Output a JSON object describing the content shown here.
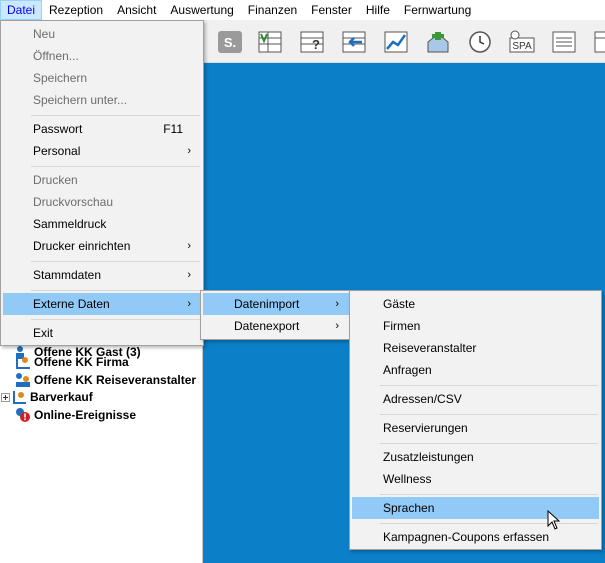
{
  "menubar": {
    "items": [
      {
        "label": "Datei"
      },
      {
        "label": "Rezeption"
      },
      {
        "label": "Ansicht"
      },
      {
        "label": "Auswertung"
      },
      {
        "label": "Finanzen"
      },
      {
        "label": "Fenster"
      },
      {
        "label": "Hilfe"
      },
      {
        "label": "Fernwartung"
      }
    ]
  },
  "toolbar": {
    "icons": [
      "s-icon",
      "v-grid-icon",
      "question-grid-icon",
      "import-arrow-icon",
      "chart-icon",
      "house-plus-icon",
      "clock-icon",
      "spa-icon",
      "list-icon",
      "partial-icon"
    ],
    "s_label": "S.",
    "spa_label": "SPA"
  },
  "datei_menu": {
    "items": [
      {
        "label": "Neu",
        "disabled": true
      },
      {
        "label": "Öffnen...",
        "disabled": true
      },
      {
        "label": "Speichern",
        "disabled": true
      },
      {
        "label": "Speichern unter...",
        "disabled": true
      },
      {
        "label": "Passwort",
        "shortcut": "F11"
      },
      {
        "label": "Personal",
        "arrow": "›"
      },
      {
        "label": "Drucken",
        "disabled": true
      },
      {
        "label": "Druckvorschau",
        "disabled": true
      },
      {
        "label": "Sammeldruck"
      },
      {
        "label": "Drucker einrichten",
        "arrow": "›"
      },
      {
        "label": "Stammdaten",
        "arrow": "›"
      },
      {
        "label": "Externe Daten",
        "arrow": "›"
      },
      {
        "label": "Exit"
      }
    ]
  },
  "externe_menu": {
    "items": [
      {
        "label": "Datenimport",
        "arrow": "›"
      },
      {
        "label": "Datenexport",
        "arrow": "›"
      }
    ]
  },
  "import_menu": {
    "items": [
      {
        "label": "Gäste"
      },
      {
        "label": "Firmen"
      },
      {
        "label": "Reiseveranstalter"
      },
      {
        "label": "Anfragen"
      },
      {
        "label": "Adressen/CSV"
      },
      {
        "label": "Reservierungen"
      },
      {
        "label": "Zusatzleistungen"
      },
      {
        "label": "Wellness"
      },
      {
        "label": "Sprachen"
      },
      {
        "label": "Kampagnen-Coupons erfassen"
      }
    ]
  },
  "tree": {
    "items": [
      {
        "label": "Offene KK Gast (3)"
      },
      {
        "label": "Offene KK Firma"
      },
      {
        "label": "Offene KK Reiseveranstalter"
      },
      {
        "label": "Barverkauf"
      },
      {
        "label": "Online-Ereignisse"
      }
    ]
  },
  "colors": {
    "workspace": "#0b7fc7",
    "highlight": "#91c9f7",
    "menu_bg": "#f2f2f2"
  }
}
